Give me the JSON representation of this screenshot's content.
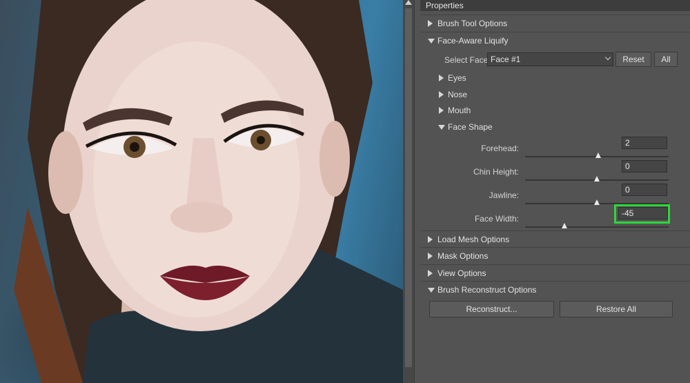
{
  "panel": {
    "title": "Properties",
    "sections": {
      "brush_tool": "Brush Tool Options",
      "face_aware": "Face-Aware Liquify",
      "load_mesh": "Load Mesh Options",
      "mask": "Mask Options",
      "view": "View Options",
      "brush_reconstruct": "Brush Reconstruct Options"
    },
    "select_face": {
      "label": "Select Face:",
      "value": "Face #1",
      "reset_label": "Reset",
      "all_label": "All"
    },
    "subsections": {
      "eyes": "Eyes",
      "nose": "Nose",
      "mouth": "Mouth",
      "face_shape": "Face Shape"
    },
    "face_shape": {
      "forehead": {
        "label": "Forehead:",
        "value": "2"
      },
      "chin_height": {
        "label": "Chin Height:",
        "value": "0"
      },
      "jawline": {
        "label": "Jawline:",
        "value": "0"
      },
      "face_width": {
        "label": "Face Width:",
        "value": "-45"
      }
    },
    "reconstruct": {
      "reconstruct_label": "Reconstruct...",
      "restore_all_label": "Restore All"
    }
  },
  "icons": {
    "collapsed": "triangle-right-icon",
    "expanded": "triangle-down-icon",
    "dropdown": "chevron-down-icon"
  },
  "colors": {
    "panel_bg": "#535353",
    "highlight": "#2bd83a"
  }
}
